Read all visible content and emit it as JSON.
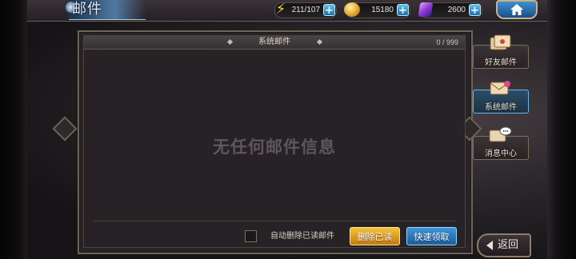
{
  "header": {
    "title": "邮件",
    "energy": "211/107",
    "gold": "15180",
    "gems": "2600",
    "plus_symbol": "+"
  },
  "panel": {
    "tab_title": "系统邮件",
    "count": "0 / 999",
    "empty_message": "无任何邮件信息"
  },
  "footer": {
    "auto_delete_label": "自动删除已读邮件",
    "delete_read_label": "删除已读",
    "quick_claim_label": "快速领取"
  },
  "tabs": [
    {
      "label": "好友邮件",
      "icon": "letters-icon",
      "selected": false
    },
    {
      "label": "系统邮件",
      "icon": "envelope-ribbon-icon",
      "selected": true
    },
    {
      "label": "消息中心",
      "icon": "speech-bubble-icon",
      "selected": false
    }
  ],
  "back_label": "返回",
  "colors": {
    "accent_blue": "#3f95d8",
    "accent_gold": "#f6c23a",
    "frame": "#6f6458"
  }
}
